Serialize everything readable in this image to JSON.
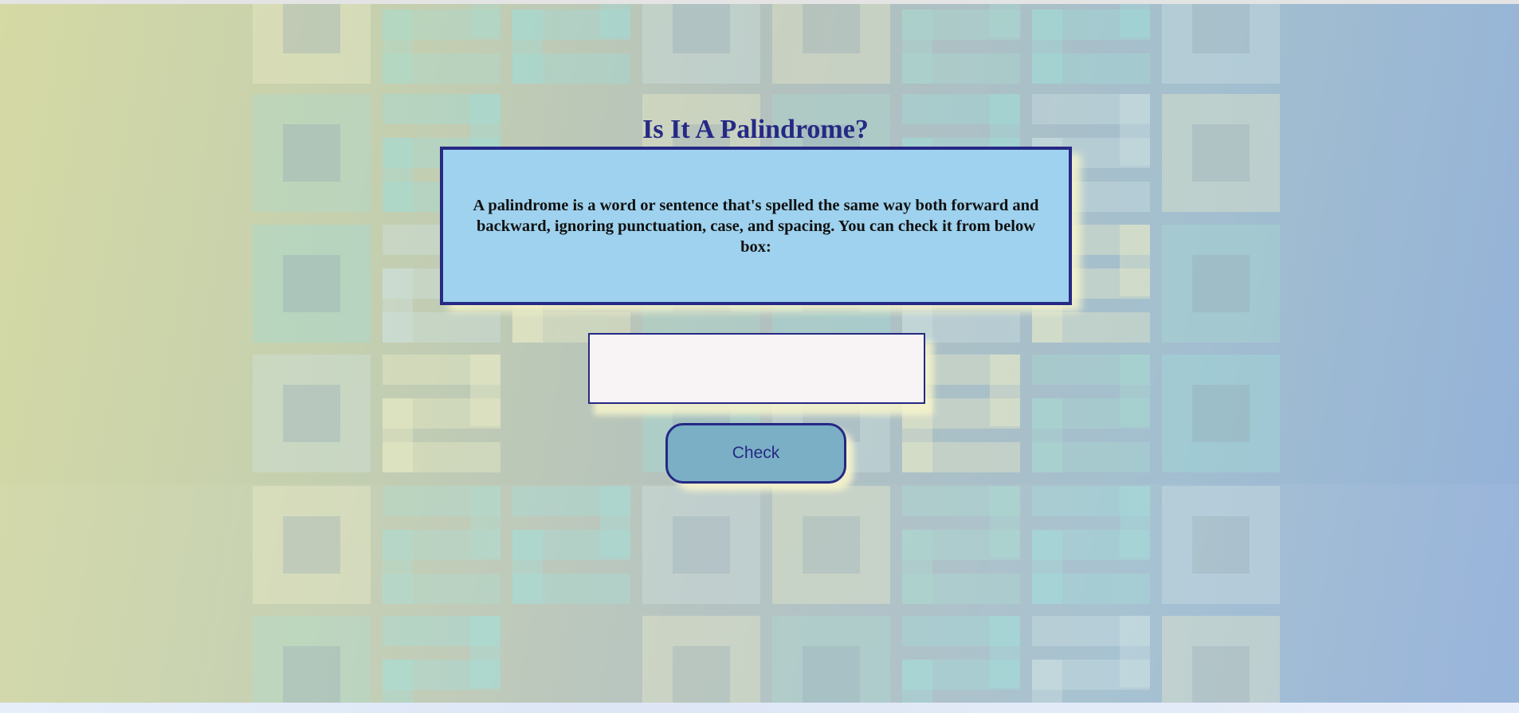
{
  "header": {
    "title": "Is It A Palindrome?"
  },
  "description": {
    "text": "A palindrome is a word or sentence that's spelled the same way both forward and backward, ignoring punctuation, case, and spacing. You can check it from below box:"
  },
  "form": {
    "input_value": "",
    "input_placeholder": "",
    "check_label": "Check"
  },
  "colors": {
    "accent": "#262984",
    "info_box_bg": "#9ed2ee",
    "button_bg": "#7aafc6",
    "input_bg": "#f8f4f5",
    "shadow": "#f8f5cc"
  }
}
